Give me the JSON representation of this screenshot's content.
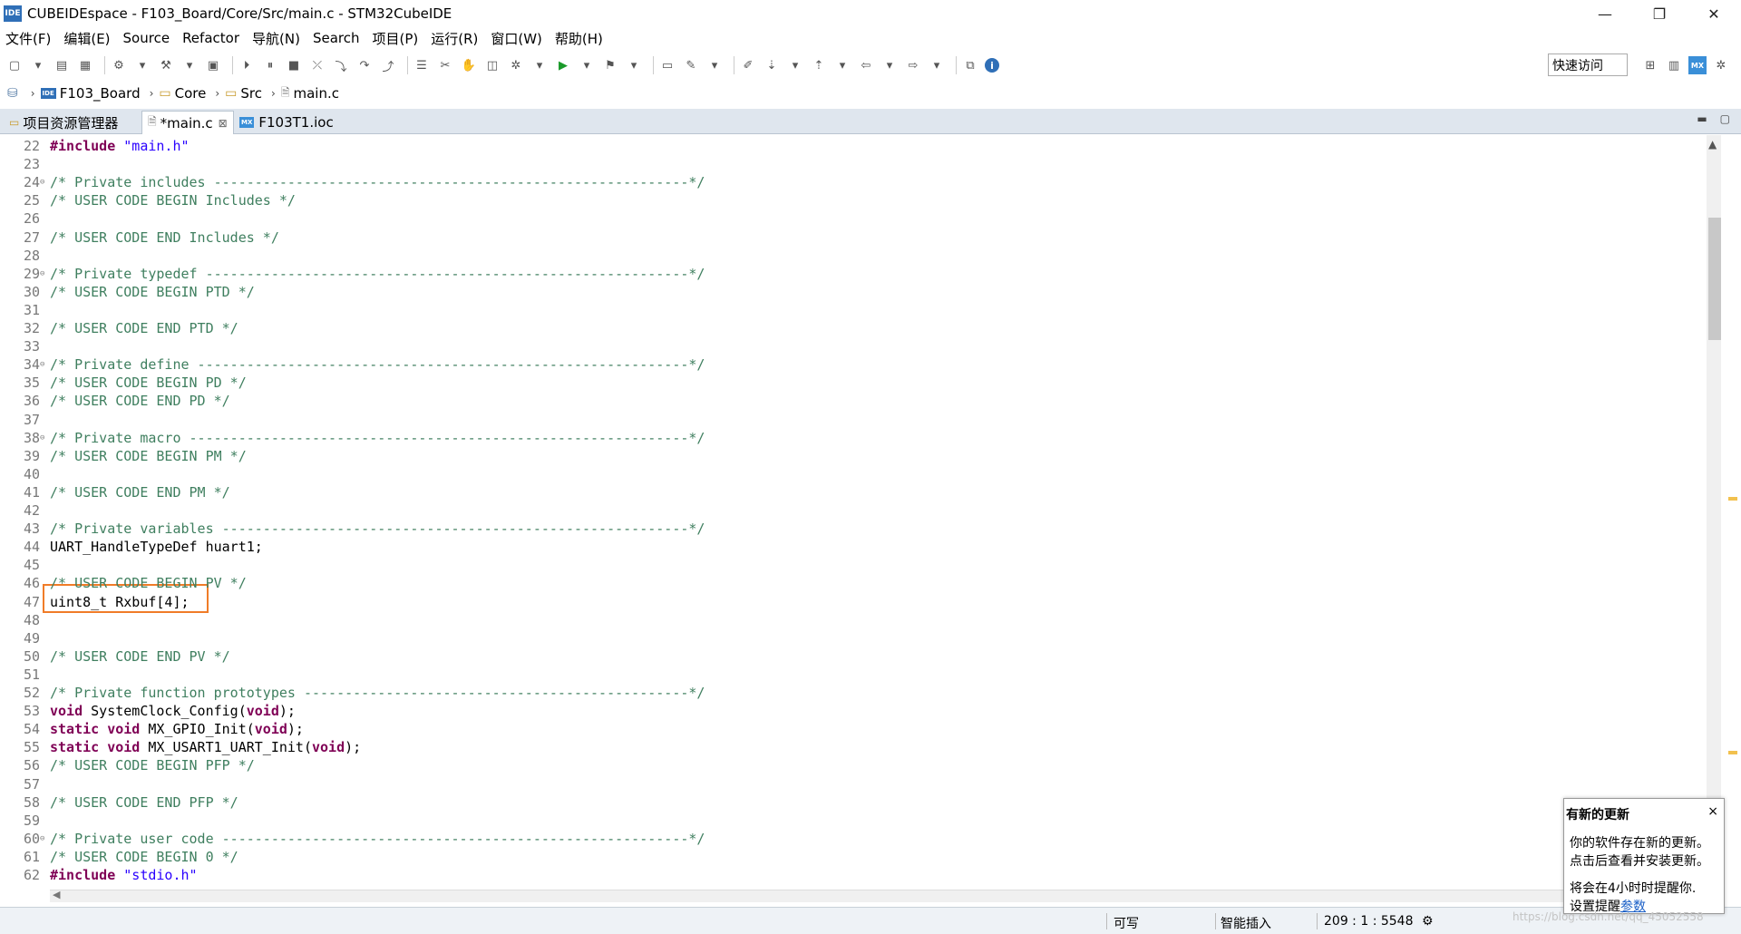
{
  "window": {
    "title": "CUBEIDEspace - F103_Board/Core/Src/main.c - STM32CubeIDE",
    "icon_label": "IDE",
    "minimize": "—",
    "restore": "❐",
    "close": "✕"
  },
  "menu": [
    "文件(F)",
    "编辑(E)",
    "Source",
    "Refactor",
    "导航(N)",
    "Search",
    "项目(P)",
    "运行(R)",
    "窗口(W)",
    "帮助(H)"
  ],
  "toolbar": {
    "quick_access": "快速访问"
  },
  "breadcrumb": {
    "project": "F103_Board",
    "folder1": "Core",
    "folder2": "Src",
    "file": "main.c"
  },
  "tabs": {
    "explorer": "项目资源管理器",
    "main": "*main.c",
    "ioc": "F103T1.ioc",
    "mx_label": "MX",
    "ide_label": "IDE"
  },
  "code_lines": [
    {
      "n": "22",
      "fold": "",
      "parts": [
        {
          "t": "#include",
          "c": "kw"
        },
        {
          "t": " ",
          "c": ""
        },
        {
          "t": "\"main.h\"",
          "c": "str"
        }
      ]
    },
    {
      "n": "23",
      "fold": "",
      "parts": []
    },
    {
      "n": "24",
      "fold": "⊖",
      "parts": [
        {
          "t": "/* Private includes ----------------------------------------------------------*/",
          "c": "comment"
        }
      ]
    },
    {
      "n": "25",
      "fold": "",
      "parts": [
        {
          "t": "/* USER CODE BEGIN Includes */",
          "c": "comment"
        }
      ]
    },
    {
      "n": "26",
      "fold": "",
      "parts": []
    },
    {
      "n": "27",
      "fold": "",
      "parts": [
        {
          "t": "/* USER CODE END Includes */",
          "c": "comment"
        }
      ]
    },
    {
      "n": "28",
      "fold": "",
      "parts": []
    },
    {
      "n": "29",
      "fold": "⊖",
      "parts": [
        {
          "t": "/* Private typedef -----------------------------------------------------------*/",
          "c": "comment"
        }
      ]
    },
    {
      "n": "30",
      "fold": "",
      "parts": [
        {
          "t": "/* USER CODE BEGIN PTD */",
          "c": "comment"
        }
      ]
    },
    {
      "n": "31",
      "fold": "",
      "parts": []
    },
    {
      "n": "32",
      "fold": "",
      "parts": [
        {
          "t": "/* USER CODE END PTD */",
          "c": "comment"
        }
      ]
    },
    {
      "n": "33",
      "fold": "",
      "parts": []
    },
    {
      "n": "34",
      "fold": "⊖",
      "parts": [
        {
          "t": "/* Private define ------------------------------------------------------------*/",
          "c": "comment"
        }
      ]
    },
    {
      "n": "35",
      "fold": "",
      "parts": [
        {
          "t": "/* USER CODE BEGIN PD */",
          "c": "comment"
        }
      ]
    },
    {
      "n": "36",
      "fold": "",
      "parts": [
        {
          "t": "/* USER CODE END PD */",
          "c": "comment"
        }
      ]
    },
    {
      "n": "37",
      "fold": "",
      "parts": []
    },
    {
      "n": "38",
      "fold": "⊖",
      "parts": [
        {
          "t": "/* Private macro -------------------------------------------------------------*/",
          "c": "comment"
        }
      ]
    },
    {
      "n": "39",
      "fold": "",
      "parts": [
        {
          "t": "/* USER CODE BEGIN PM */",
          "c": "comment"
        }
      ]
    },
    {
      "n": "40",
      "fold": "",
      "parts": []
    },
    {
      "n": "41",
      "fold": "",
      "parts": [
        {
          "t": "/* USER CODE END PM */",
          "c": "comment"
        }
      ]
    },
    {
      "n": "42",
      "fold": "",
      "parts": []
    },
    {
      "n": "43",
      "fold": "",
      "parts": [
        {
          "t": "/* Private variables ---------------------------------------------------------*/",
          "c": "comment"
        }
      ]
    },
    {
      "n": "44",
      "fold": "",
      "parts": [
        {
          "t": "UART_HandleTypeDef huart1;",
          "c": ""
        }
      ]
    },
    {
      "n": "45",
      "fold": "",
      "parts": []
    },
    {
      "n": "46",
      "fold": "",
      "parts": [
        {
          "t": "/* USER CODE BEGIN PV */",
          "c": "comment"
        }
      ]
    },
    {
      "n": "47",
      "fold": "",
      "parts": [
        {
          "t": "uint8_t Rxbuf[4];",
          "c": ""
        }
      ]
    },
    {
      "n": "48",
      "fold": "",
      "parts": []
    },
    {
      "n": "49",
      "fold": "",
      "parts": []
    },
    {
      "n": "50",
      "fold": "",
      "parts": [
        {
          "t": "/* USER CODE END PV */",
          "c": "comment"
        }
      ]
    },
    {
      "n": "51",
      "fold": "",
      "parts": []
    },
    {
      "n": "52",
      "fold": "",
      "parts": [
        {
          "t": "/* Private function prototypes -----------------------------------------------*/",
          "c": "comment"
        }
      ]
    },
    {
      "n": "53",
      "fold": "",
      "parts": [
        {
          "t": "void",
          "c": "kw"
        },
        {
          "t": " SystemClock_Config(",
          "c": ""
        },
        {
          "t": "void",
          "c": "kw"
        },
        {
          "t": ");",
          "c": ""
        }
      ]
    },
    {
      "n": "54",
      "fold": "",
      "parts": [
        {
          "t": "static",
          "c": "kw"
        },
        {
          "t": " ",
          "c": ""
        },
        {
          "t": "void",
          "c": "kw"
        },
        {
          "t": " MX_GPIO_Init(",
          "c": ""
        },
        {
          "t": "void",
          "c": "kw"
        },
        {
          "t": ");",
          "c": ""
        }
      ]
    },
    {
      "n": "55",
      "fold": "",
      "parts": [
        {
          "t": "static",
          "c": "kw"
        },
        {
          "t": " ",
          "c": ""
        },
        {
          "t": "void",
          "c": "kw"
        },
        {
          "t": " MX_USART1_UART_Init(",
          "c": ""
        },
        {
          "t": "void",
          "c": "kw"
        },
        {
          "t": ");",
          "c": ""
        }
      ]
    },
    {
      "n": "56",
      "fold": "",
      "parts": [
        {
          "t": "/* USER CODE BEGIN PFP */",
          "c": "comment"
        }
      ]
    },
    {
      "n": "57",
      "fold": "",
      "parts": []
    },
    {
      "n": "58",
      "fold": "",
      "parts": [
        {
          "t": "/* USER CODE END PFP */",
          "c": "comment"
        }
      ]
    },
    {
      "n": "59",
      "fold": "",
      "parts": []
    },
    {
      "n": "60",
      "fold": "⊖",
      "parts": [
        {
          "t": "/* Private user code ---------------------------------------------------------*/",
          "c": "comment"
        }
      ]
    },
    {
      "n": "61",
      "fold": "",
      "parts": [
        {
          "t": "/* USER CODE BEGIN 0 */",
          "c": "comment"
        }
      ]
    },
    {
      "n": "62",
      "fold": "",
      "parts": [
        {
          "t": "#include",
          "c": "kw"
        },
        {
          "t": " ",
          "c": ""
        },
        {
          "t": "\"stdio.h\"",
          "c": "str"
        }
      ]
    }
  ],
  "status": {
    "writable": "可写",
    "insert_mode": "智能插入",
    "position": "209 : 1 : 5548"
  },
  "popup": {
    "title": "有新的更新",
    "close": "×",
    "line1": "你的软件存在新的更新。",
    "line2": "点击后查看并安装更新。",
    "line3": "将会在4小时时提醒你.",
    "line4_prefix": "设置提醒",
    "line4_link": "参数"
  },
  "watermark": "https://blog.csdn.net/qq_45052558",
  "colors": {
    "comment": "#3f7f5f",
    "keyword": "#7f0055",
    "string": "#2a00ff",
    "highlight_box": "#f07c28"
  }
}
